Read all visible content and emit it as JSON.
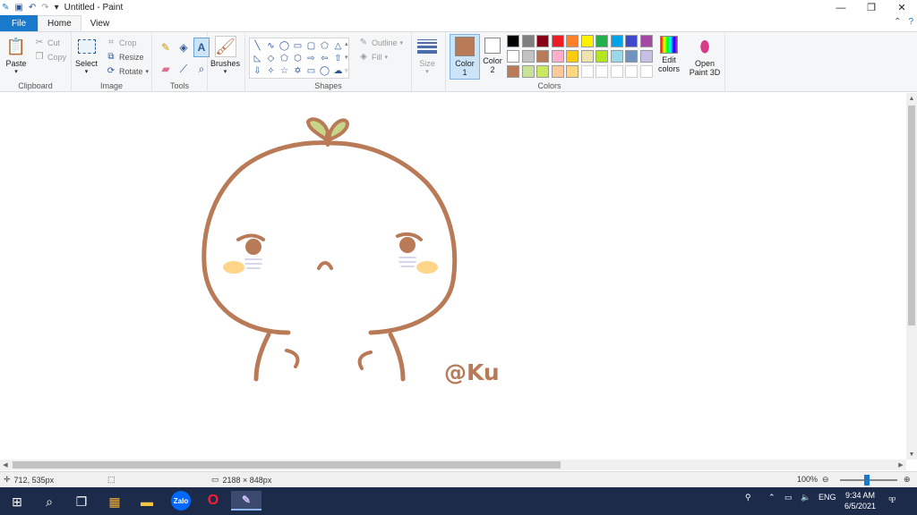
{
  "window": {
    "title": "Untitled - Paint"
  },
  "tabs": [
    {
      "label": "File"
    },
    {
      "label": "Home"
    },
    {
      "label": "View"
    }
  ],
  "ribbon": {
    "clipboard": {
      "paste": "Paste",
      "cut": "Cut",
      "copy": "Copy",
      "label": "Clipboard"
    },
    "image": {
      "select": "Select",
      "crop": "Crop",
      "resize": "Resize",
      "rotate": "Rotate",
      "label": "Image"
    },
    "tools": {
      "label": "Tools"
    },
    "brushes": {
      "label": "Brushes"
    },
    "shapes": {
      "outline": "Outline",
      "fill": "Fill",
      "label": "Shapes"
    },
    "size": {
      "label": "Size"
    },
    "colors": {
      "color1": "Color 1",
      "color2": "Color 2",
      "edit": "Edit colors",
      "paint3d": "Open Paint 3D",
      "label": "Colors",
      "color1_value": "#b97a57",
      "color2_value": "#ffffff",
      "palette_row1": [
        "#000000",
        "#7f7f7f",
        "#880015",
        "#ed1c24",
        "#ff7f27",
        "#fff200",
        "#22b14c",
        "#00a2e8",
        "#3f48cc",
        "#a349a4"
      ],
      "palette_row2": [
        "#ffffff",
        "#c3c3c3",
        "#b97a57",
        "#ffaec9",
        "#ffc90e",
        "#efe4b0",
        "#b5e61d",
        "#99d9ea",
        "#7092be",
        "#c8bfe7"
      ],
      "palette_row3": [
        "#b97a57",
        "#c8e29a",
        "#c9e862",
        "#ffc89b",
        "#ffd680",
        "#ffffff",
        "#ffffff",
        "#ffffff",
        "#ffffff",
        "#ffffff"
      ]
    }
  },
  "canvas": {
    "signature": "@Ku",
    "stroke_color": "#b97a57",
    "sprout_color": "#c8d48a",
    "blush_color": "#ffd58a",
    "tear_color": "#c9c9e6"
  },
  "status": {
    "cursor": "712, 535px",
    "canvas_size": "2188 × 848px",
    "zoom": "100%"
  },
  "taskbar": {
    "apps": [
      "Zalo",
      "Opera",
      "Paint"
    ],
    "lang": "ENG",
    "time": "9:34 AM",
    "date": "6/5/2021",
    "notifications": "1"
  }
}
